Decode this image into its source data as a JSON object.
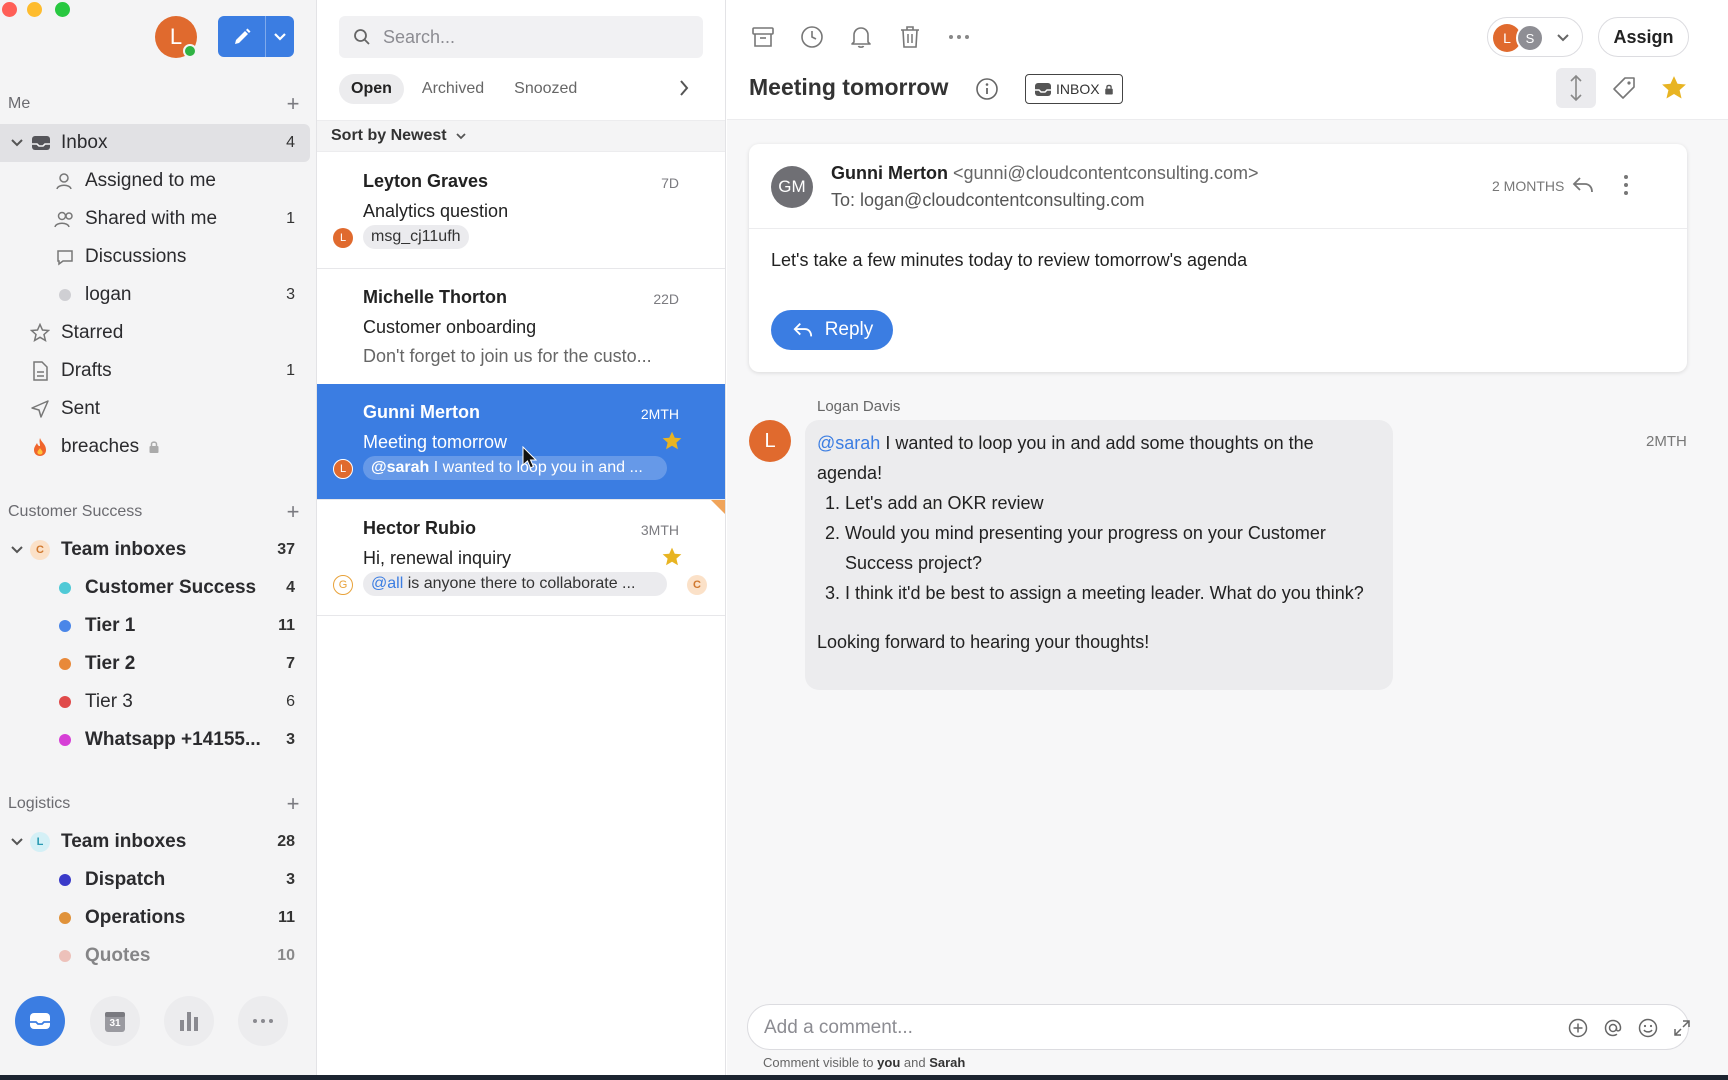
{
  "colors": {
    "accent": "#3b7de2",
    "orange": "#e06a2e",
    "star": "#e8b422",
    "presence": "#2fb344"
  },
  "sidebar": {
    "me_avatar": "L",
    "section_me": "Me",
    "inbox": {
      "label": "Inbox",
      "count": "4"
    },
    "items": [
      {
        "label": "Assigned to me",
        "count": ""
      },
      {
        "label": "Shared with me",
        "count": "1"
      },
      {
        "label": "Discussions",
        "count": ""
      },
      {
        "label": "logan",
        "count": "3"
      },
      {
        "label": "Starred",
        "count": ""
      },
      {
        "label": "Drafts",
        "count": "1"
      },
      {
        "label": "Sent",
        "count": ""
      },
      {
        "label": "breaches",
        "count": ""
      }
    ],
    "customer_success": {
      "section": "Customer Success",
      "team_badge": "C",
      "team_label": "Team inboxes",
      "team_count": "37",
      "inboxes": [
        {
          "label": "Customer Success",
          "count": "4",
          "color": "#4fc9d6"
        },
        {
          "label": "Tier 1",
          "count": "11",
          "color": "#4a86e8"
        },
        {
          "label": "Tier 2",
          "count": "7",
          "color": "#e8893a"
        },
        {
          "label": "Tier 3",
          "count": "6",
          "color": "#e04a4a"
        },
        {
          "label": "Whatsapp +14155...",
          "count": "3",
          "color": "#d63fd6"
        }
      ]
    },
    "logistics": {
      "section": "Logistics",
      "team_badge": "L",
      "team_label": "Team inboxes",
      "team_count": "28",
      "inboxes": [
        {
          "label": "Dispatch",
          "count": "3",
          "color": "#3a3ac9"
        },
        {
          "label": "Operations",
          "count": "11",
          "color": "#e0923a"
        },
        {
          "label": "Quotes",
          "count": "10",
          "color": "#e8998a"
        }
      ]
    },
    "calendar_day": "31"
  },
  "list": {
    "search_placeholder": "Search...",
    "tabs": [
      "Open",
      "Archived",
      "Snoozed"
    ],
    "sort_label": "Sort by Newest",
    "conversations": [
      {
        "name": "Leyton Graves",
        "age": "7D",
        "subject": "Analytics question",
        "chip": "msg_cj11ufh",
        "avatar": "L"
      },
      {
        "name": "Michelle Thorton",
        "age": "22D",
        "subject": "Customer onboarding",
        "preview": "Don't forget to join us for the custo..."
      },
      {
        "name": "Gunni Merton",
        "age": "2MTH",
        "subject": "Meeting tomorrow",
        "mention": "@sarah",
        "chip_rest": " I wanted to loop you in and ...",
        "avatar": "L"
      },
      {
        "name": "Hector Rubio",
        "age": "3MTH",
        "subject": "Hi, renewal inquiry",
        "mention": "@all",
        "chip_rest": " is anyone there to collaborate ...",
        "avatar": "G",
        "avatar2": "C"
      }
    ]
  },
  "detail": {
    "title": "Meeting tomorrow",
    "inbox_tag": "INBOX",
    "assignees": [
      "L",
      "S"
    ],
    "assign_label": "Assign",
    "email": {
      "avatar": "GM",
      "from_name": "Gunni Merton",
      "from_email": "<gunni@cloudcontentconsulting.com>",
      "to": "To: logan@cloudcontentconsulting.com",
      "when": "2 MONTHS",
      "body": "Let's take a few minutes today to review tomorrow's agenda",
      "reply_label": "Reply"
    },
    "comment": {
      "author": "Logan Davis",
      "avatar": "L",
      "time": "2MTH",
      "mention": "@sarah",
      "intro": " I wanted to loop you in and add some thoughts on the agenda!",
      "items": [
        "Let's add an OKR review",
        "Would you mind presenting your progress on your Customer Success project?",
        "I think it'd be best to assign a meeting leader. What do you think?"
      ],
      "closing": "Looking forward to hearing your thoughts!"
    },
    "composer_placeholder": "Add a comment...",
    "visibility_prefix": "Comment visible to ",
    "visibility_you": "you",
    "visibility_and": " and ",
    "visibility_sarah": "Sarah"
  }
}
